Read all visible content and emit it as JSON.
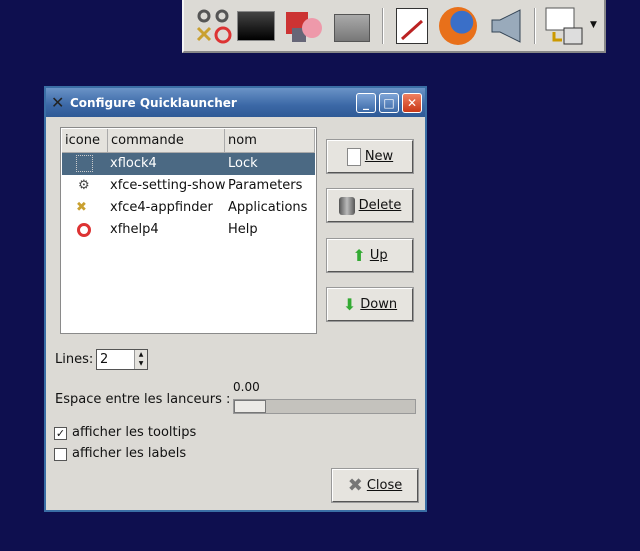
{
  "panel": {
    "icons": [
      "xfce-settings-icon",
      "terminal-icon",
      "install-package-icon",
      "file-manager-icon",
      "text-editor-icon",
      "firefox-icon",
      "sound-icon",
      "window-switcher-icon"
    ],
    "menu_arrow": "chevron-down-icon"
  },
  "dialog": {
    "title": "Configure Quicklauncher",
    "list": {
      "columns": [
        "icone",
        "commande",
        "nom"
      ],
      "rows": [
        {
          "icon": "lock-icon",
          "commande": "xflock4",
          "nom": "Lock",
          "selected": true
        },
        {
          "icon": "gear-icon",
          "commande": "xfce-setting-show",
          "nom": "Parameters"
        },
        {
          "icon": "tools-icon",
          "commande": "xfce4-appfinder",
          "nom": "Applications"
        },
        {
          "icon": "lifebuoy-icon",
          "commande": "xfhelp4",
          "nom": "Help"
        }
      ]
    },
    "buttons": {
      "new": "New",
      "delete": "Delete",
      "up": "Up",
      "down": "Down",
      "close": "Close"
    },
    "lines_label": "Lines:",
    "lines_value": "2",
    "spacing_label": "Espace entre les lanceurs :",
    "spacing_value": "0.00",
    "tooltips_label": "afficher les tooltips",
    "tooltips_checked": true,
    "labels_label": "afficher les labels",
    "labels_checked": false,
    "title_color": "#3b68a6",
    "selection_color": "#4b6983"
  }
}
